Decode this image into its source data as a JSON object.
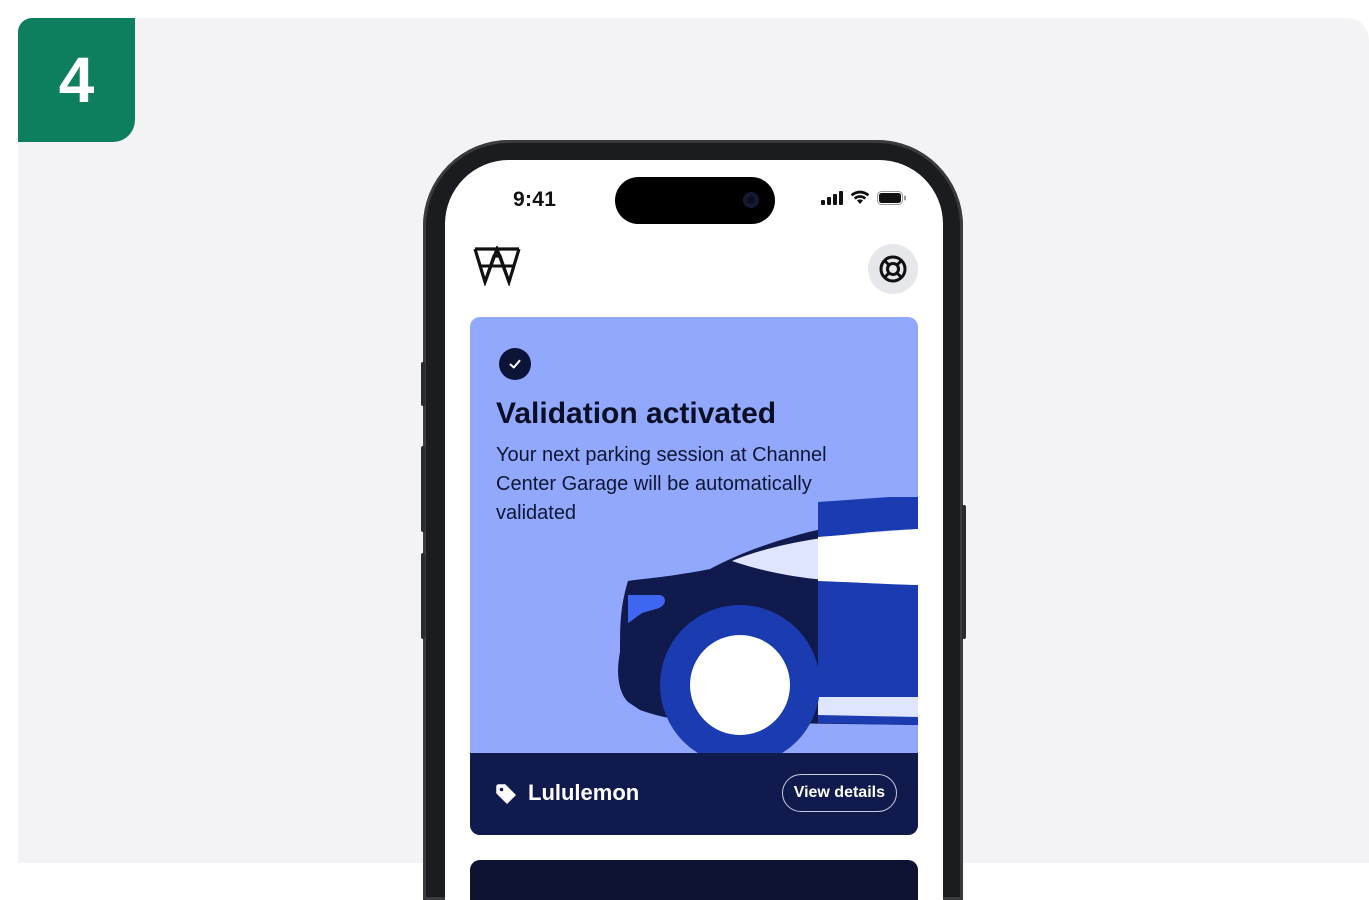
{
  "step": {
    "number": "4"
  },
  "status_bar": {
    "time": "9:41"
  },
  "header": {
    "logo_icon": "w-logo-icon",
    "help_icon": "lifebuoy-icon"
  },
  "validation_card": {
    "status_icon": "check-circle-icon",
    "title": "Validation activated",
    "message": "Your next parking session at Channel Center Garage will be automatically validated",
    "merchant_icon": "tag-icon",
    "merchant_name": "Lululemon",
    "details_button": "View details"
  },
  "colors": {
    "badge": "#0d7f5f",
    "card_background": "#91a8fd",
    "card_footer": "#101a4d",
    "car_dark": "#101a4d",
    "car_blue": "#1b3bb0"
  }
}
